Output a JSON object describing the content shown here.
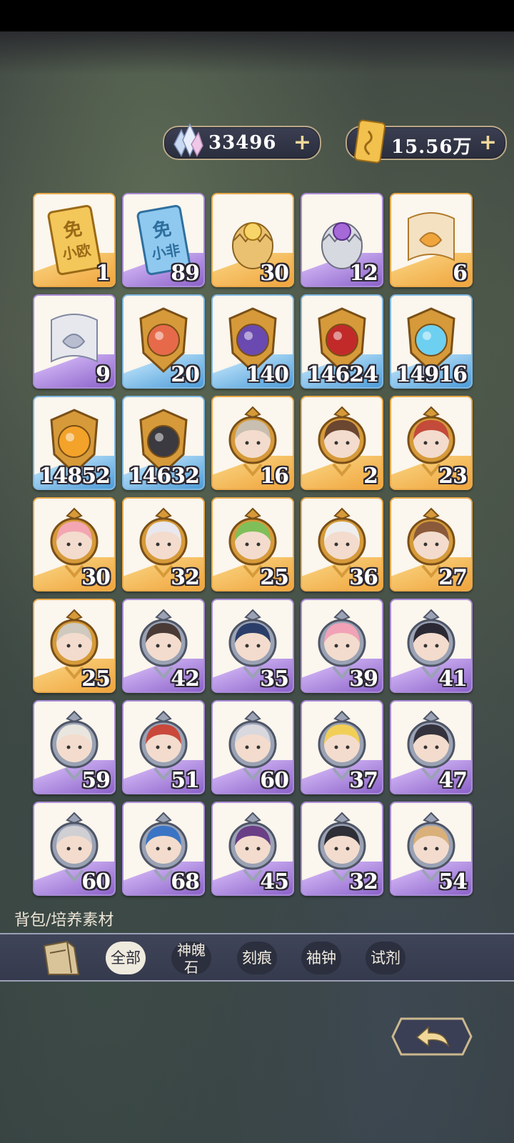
{
  "currencies": {
    "gems": {
      "value": "33496",
      "plus": "+",
      "icon": "crystal-icon"
    },
    "tickets": {
      "value": "15.56万",
      "plus": "+",
      "icon": "gold-ticket-icon"
    }
  },
  "items": [
    {
      "count": "1",
      "rarity": "gold",
      "icon": "gold-free-ticket-icon",
      "ticket_text": [
        "免",
        "小欧"
      ]
    },
    {
      "count": "89",
      "rarity": "purple",
      "icon": "blue-free-ticket-icon",
      "ticket_text": [
        "免",
        "小非"
      ]
    },
    {
      "count": "30",
      "rarity": "gold",
      "icon": "gold-egg-icon"
    },
    {
      "count": "12",
      "rarity": "purple",
      "icon": "silver-egg-icon"
    },
    {
      "count": "6",
      "rarity": "gold",
      "icon": "gold-scroll-icon"
    },
    {
      "count": "9",
      "rarity": "purple",
      "icon": "silver-scroll-icon"
    },
    {
      "count": "20",
      "rarity": "blue",
      "icon": "fire-crest-icon"
    },
    {
      "count": "140",
      "rarity": "blue",
      "icon": "shadow-crest-icon"
    },
    {
      "count": "14624",
      "rarity": "blue",
      "icon": "dragon-crest-icon"
    },
    {
      "count": "14916",
      "rarity": "blue",
      "icon": "ice-crest-icon"
    },
    {
      "count": "14852",
      "rarity": "blue",
      "icon": "sun-crest-icon"
    },
    {
      "count": "14632",
      "rarity": "blue",
      "icon": "dark-crest-icon"
    },
    {
      "count": "16",
      "rarity": "gold",
      "icon": "portrait-pink-hair-icon"
    },
    {
      "count": "2",
      "rarity": "gold",
      "icon": "portrait-black-hair-icon"
    },
    {
      "count": "23",
      "rarity": "gold",
      "icon": "portrait-white-hair-icon"
    },
    {
      "count": "30",
      "rarity": "gold",
      "icon": "portrait-red-hair-icon"
    },
    {
      "count": "32",
      "rarity": "gold",
      "icon": "portrait-silver-hair-icon"
    },
    {
      "count": "25",
      "rarity": "gold",
      "icon": "portrait-blonde-hair-icon"
    },
    {
      "count": "36",
      "rarity": "gold",
      "icon": "portrait-dark-hair-icon"
    },
    {
      "count": "27",
      "rarity": "gold",
      "icon": "portrait-grey-hair-icon"
    },
    {
      "count": "25",
      "rarity": "gold",
      "icon": "portrait-blue-hair-icon"
    },
    {
      "count": "42",
      "rarity": "purple",
      "icon": "portrait-violet-hair-icon"
    },
    {
      "count": "35",
      "rarity": "purple",
      "icon": "portrait-masked-icon"
    },
    {
      "count": "39",
      "rarity": "purple",
      "icon": "portrait-tan-hair-icon"
    },
    {
      "count": "41",
      "rarity": "purple",
      "icon": "portrait-ash-hair-icon"
    },
    {
      "count": "59",
      "rarity": "purple",
      "icon": "portrait-brown-hair-icon"
    },
    {
      "count": "51",
      "rarity": "purple",
      "icon": "portrait-crimson-hair-icon"
    },
    {
      "count": "60",
      "rarity": "purple",
      "icon": "portrait-rose-hair-icon"
    },
    {
      "count": "37",
      "rarity": "purple",
      "icon": "portrait-white-flower-icon"
    },
    {
      "count": "47",
      "rarity": "purple",
      "icon": "portrait-green-hair-icon"
    },
    {
      "count": "60",
      "rarity": "purple",
      "icon": "portrait-white-long-hair-icon"
    },
    {
      "count": "68",
      "rarity": "purple",
      "icon": "portrait-auburn-hair-icon"
    },
    {
      "count": "45",
      "rarity": "purple",
      "icon": "portrait-pale-hair-icon"
    },
    {
      "count": "32",
      "rarity": "purple",
      "icon": "portrait-ribbon-hair-icon"
    },
    {
      "count": "54",
      "rarity": "purple",
      "icon": "portrait-hat-icon"
    }
  ],
  "breadcrumb": "背包/培养素材",
  "tabs": [
    {
      "label": "全部",
      "active": true
    },
    {
      "label_line1": "神魄",
      "label_line2": "石",
      "active": false
    },
    {
      "label": "刻痕",
      "active": false
    },
    {
      "label": "袖钟",
      "active": false
    },
    {
      "label": "试剂",
      "active": false
    }
  ],
  "colors": {
    "gold": "#f0a43c",
    "purple": "#8b62c9",
    "blue": "#4c9bd8"
  }
}
